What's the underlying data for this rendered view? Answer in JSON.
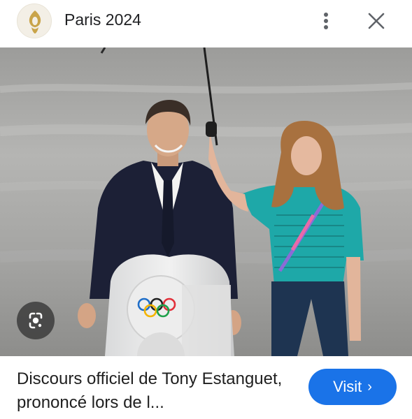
{
  "header": {
    "title": "Paris 2024",
    "logo_icon": "paris-2024-logo-icon",
    "more_icon": "more-vertical-icon",
    "close_icon": "close-icon"
  },
  "image": {
    "lens_icon": "google-lens-icon"
  },
  "result": {
    "caption": "Discours officiel de Tony Estanguet, prononcé lors de l...",
    "visit_label": "Visit",
    "visit_chevron": "›"
  },
  "colors": {
    "accent": "#1a73e8",
    "logo_gold": "#c9a44a"
  }
}
